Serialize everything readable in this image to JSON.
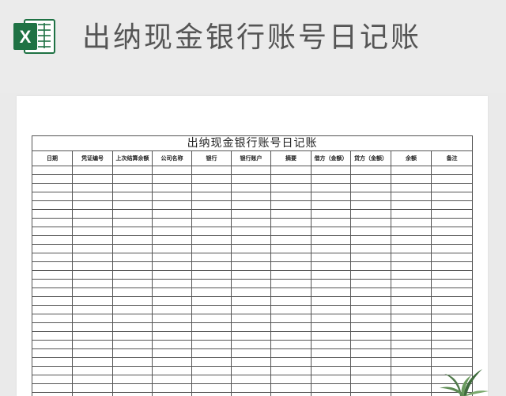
{
  "banner": {
    "app_icon": "excel-icon",
    "app_icon_letter": "X",
    "title": "出纳现金银行账号日记账"
  },
  "sheet": {
    "title": "出纳现金银行账号日记账",
    "columns": [
      "日期",
      "凭证编号",
      "上次结算余额",
      "公司名称",
      "银行",
      "银行账户",
      "摘要",
      "借方（金额）",
      "贷方（金额）",
      "余额",
      "备注"
    ],
    "empty_row_count": 27
  },
  "decoration": {
    "plant_icon": "plant-icon"
  },
  "colors": {
    "excel_green": "#1f7244",
    "grid_line": "#555555",
    "title_gray": "#555555"
  }
}
